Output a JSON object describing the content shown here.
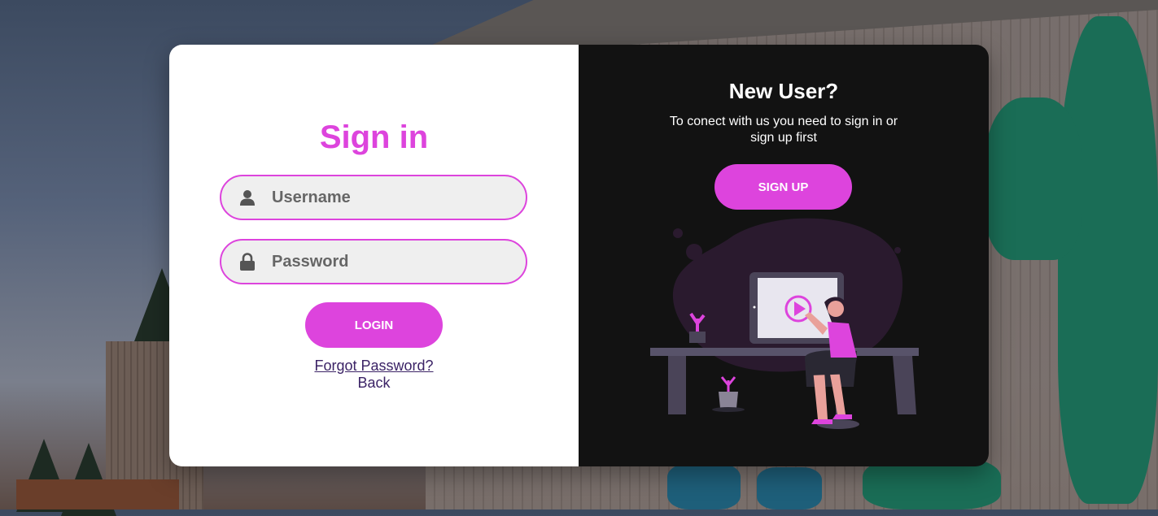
{
  "signin": {
    "title": "Sign in",
    "username_placeholder": "Username",
    "password_placeholder": "Password",
    "login_label": "LOGIN",
    "forgot_label": "Forgot Password?",
    "back_label": "Back"
  },
  "signup_panel": {
    "title": "New User?",
    "description": "To conect with us you need to sign in or sign up first",
    "signup_label": "SIGN UP"
  },
  "icons": {
    "username": "user-icon",
    "password": "lock-icon",
    "illustration": "person-watching-video-illustration"
  },
  "colors": {
    "accent": "#dd44dd",
    "panel_dark": "#121212",
    "link": "#3b2366"
  }
}
